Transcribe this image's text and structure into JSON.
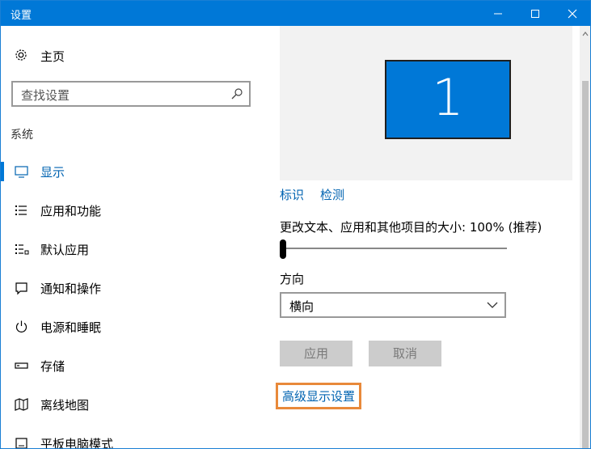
{
  "window": {
    "title": "设置"
  },
  "sidebar": {
    "home_label": "主页",
    "search_placeholder": "查找设置",
    "section": "系统",
    "items": [
      {
        "label": "显示",
        "icon": "monitor-icon",
        "active": true
      },
      {
        "label": "应用和功能",
        "icon": "list-icon"
      },
      {
        "label": "默认应用",
        "icon": "default-apps-icon"
      },
      {
        "label": "通知和操作",
        "icon": "notification-icon"
      },
      {
        "label": "电源和睡眠",
        "icon": "power-icon"
      },
      {
        "label": "存储",
        "icon": "storage-icon"
      },
      {
        "label": "离线地图",
        "icon": "map-icon"
      },
      {
        "label": "平板电脑模式",
        "icon": "tablet-icon"
      }
    ]
  },
  "display": {
    "monitor_number": "1",
    "identify_link": "标识",
    "detect_link": "检测",
    "scale_label": "更改文本、应用和其他项目的大小: 100% (推荐)",
    "scale_level": 0,
    "orientation_label": "方向",
    "orientation_value": "横向",
    "apply_button": "应用",
    "cancel_button": "取消",
    "advanced_link": "高级显示设置"
  },
  "colors": {
    "accent": "#0078d7",
    "link": "#0063b1",
    "highlight_border": "#e8893a"
  }
}
